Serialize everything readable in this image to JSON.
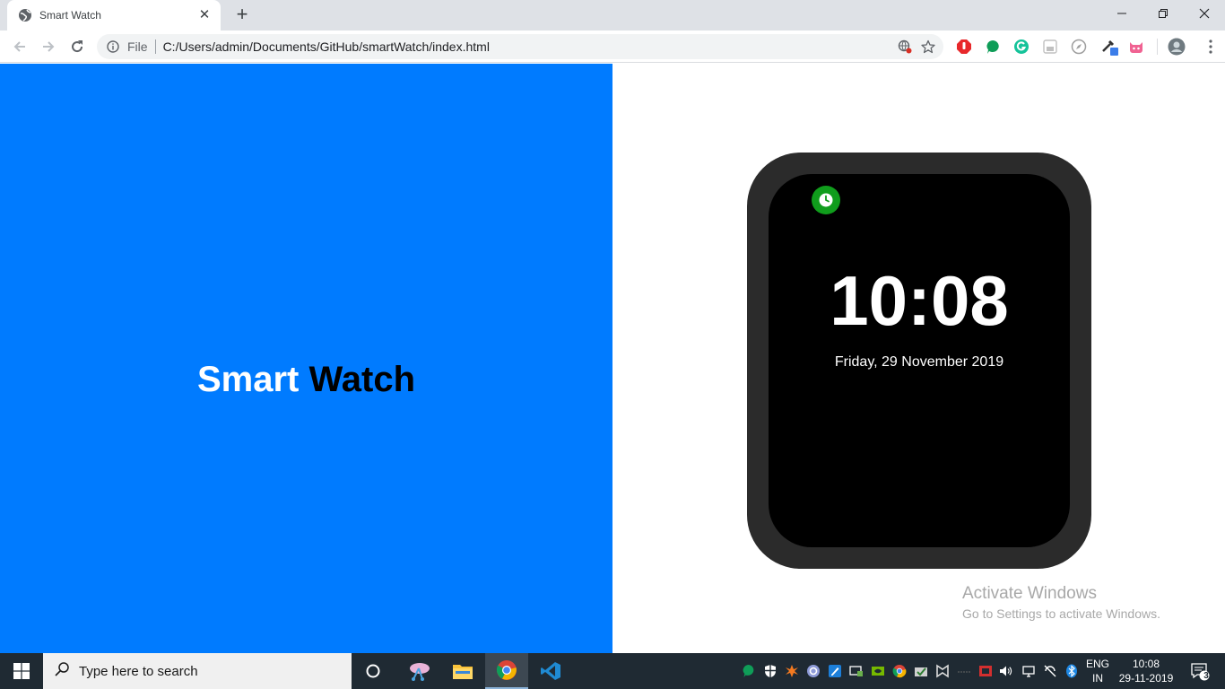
{
  "browser": {
    "tab_title": "Smart Watch",
    "tab_close": "✕",
    "new_tab": "+",
    "scheme": "File",
    "url": "C:/Users/admin/Documents/GitHub/smartWatch/index.html"
  },
  "page": {
    "hero_word_1": "Smart",
    "hero_word_2": "Watch",
    "watch_time": "10:08",
    "watch_date": "Friday, 29 November 2019",
    "activate_title": "Activate Windows",
    "activate_subtitle": "Go to Settings to activate Windows."
  },
  "taskbar": {
    "search_placeholder": "Type here to search",
    "lang_line1": "ENG",
    "lang_line2": "IN",
    "time": "10:08",
    "date": "29-11-2019",
    "notification_count": "3"
  },
  "colors": {
    "left_pane": "#007bff",
    "watch_body": "#2b2b2b",
    "watch_screen": "#000000",
    "clock_badge": "#109d1c",
    "taskbar": "#1f2a33"
  }
}
